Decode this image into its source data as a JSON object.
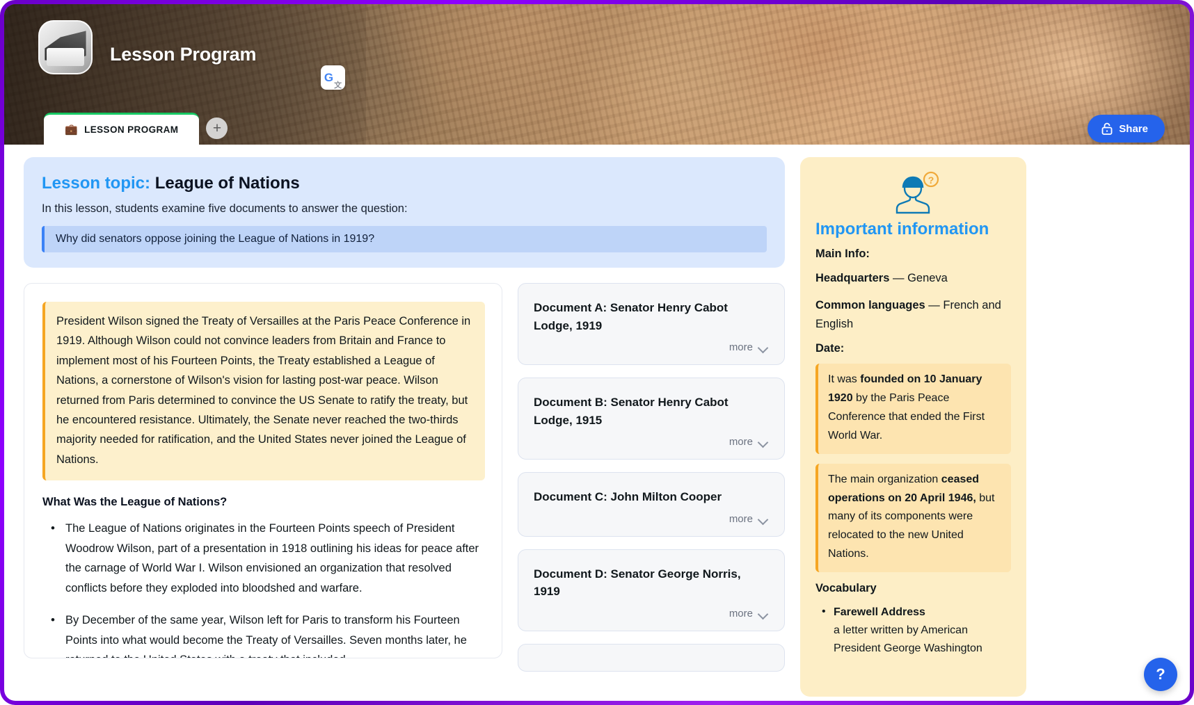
{
  "header": {
    "app_title": "Lesson Program",
    "logo_icon": "notebook-pen-icon",
    "translate_icon": "google-translate-icon",
    "translate_g": "G",
    "translate_a": "文",
    "tabs": [
      {
        "emoji": "💼",
        "label": "LESSON PROGRAM",
        "active": true
      }
    ],
    "add_tab_label": "+",
    "share_label": "Share",
    "share_icon": "unlock-icon"
  },
  "topic": {
    "label": "Lesson topic:",
    "title": "League of Nations",
    "subtitle": "In this lesson, students examine five documents to answer the question:",
    "question": "Why did senators oppose joining the League of Nations in 1919?"
  },
  "article": {
    "callout": "President Wilson signed the Treaty of Versailles at the Paris Peace Conference in 1919. Although Wilson could not convince leaders from Britain and France to implement most of his Fourteen Points, the Treaty established a League of Nations, a cornerstone of Wilson's vision for lasting post-war peace. Wilson returned from Paris determined to convince the US Senate to ratify the treaty, but he encountered resistance. Ultimately, the Senate never reached the two-thirds majority needed for ratification, and the United States never joined the League of Nations.",
    "section_title": "What Was the League of Nations?",
    "bullets": [
      "The League of Nations originates in the Fourteen Points speech of President Woodrow Wilson, part of a presentation in 1918 outlining his ideas for peace after the carnage of World War I. Wilson envisioned an organization that resolved conflicts before they exploded into bloodshed and warfare.",
      "By December of the same year, Wilson left for Paris to transform his Fourteen Points into what would become the Treaty of Versailles. Seven months later, he returned to the United States with a treaty that included"
    ]
  },
  "documents": {
    "more_label": "more",
    "chevron_icon": "chevron-down-icon",
    "items": [
      {
        "title": "Document A: Senator Henry Cabot Lodge, 1919"
      },
      {
        "title": "Document B: Senator Henry Cabot Lodge, 1915"
      },
      {
        "title": "Document C: John Milton Cooper"
      },
      {
        "title": "Document D: Senator George Norris, 1919"
      }
    ]
  },
  "info": {
    "avatar_icon": "student-question-icon",
    "title": "Important information",
    "main_info_label": "Main Info:",
    "facts": [
      {
        "term": "Headquarters",
        "dash": "—",
        "value": "Geneva"
      },
      {
        "term": "Common languages",
        "dash": "—",
        "value": "French and English"
      }
    ],
    "date_label": "Date:",
    "callouts": [
      {
        "pre": "It was ",
        "bold": "founded on 10 January 1920",
        "post": " by the Paris Peace Conference that ended the First World War."
      },
      {
        "pre": "The main organization ",
        "bold": "ceased operations on 20 April 1946,",
        "post": " but many of its components were relocated to the new United Nations."
      }
    ],
    "vocabulary_label": "Vocabulary",
    "vocabulary": [
      {
        "term": "Farewell Address",
        "definition": "a letter written by American President George Washington"
      }
    ]
  },
  "help": {
    "icon": "question-mark-icon",
    "label": "?"
  },
  "colors": {
    "accent_blue": "#2196f3",
    "share_blue": "#2563eb",
    "tab_green": "#17c964",
    "callout_yellow": "#fdf0cc",
    "info_panel": "#fdeec6",
    "topic_blue": "#dbe8fd",
    "frame_purple": "#6a00c9"
  }
}
